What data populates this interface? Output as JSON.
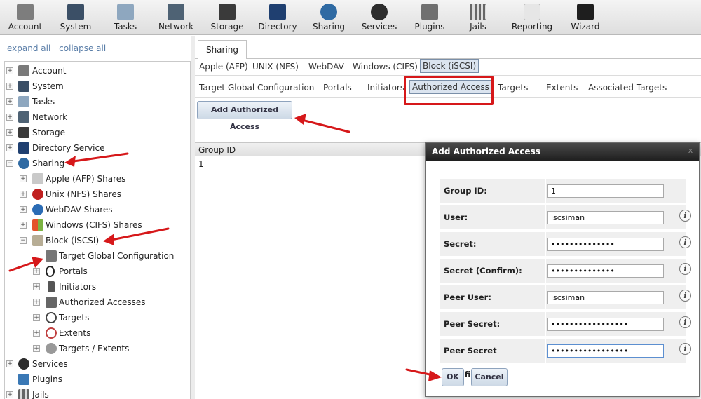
{
  "toolbar": {
    "items": [
      {
        "label": "Account",
        "icon": "account-icon"
      },
      {
        "label": "System",
        "icon": "system-icon"
      },
      {
        "label": "Tasks",
        "icon": "tasks-icon"
      },
      {
        "label": "Network",
        "icon": "network-icon"
      },
      {
        "label": "Storage",
        "icon": "storage-icon"
      },
      {
        "label": "Directory",
        "icon": "directory-icon"
      },
      {
        "label": "Sharing",
        "icon": "sharing-icon"
      },
      {
        "label": "Services",
        "icon": "services-icon"
      },
      {
        "label": "Plugins",
        "icon": "plugins-icon"
      },
      {
        "label": "Jails",
        "icon": "jails-icon"
      },
      {
        "label": "Reporting",
        "icon": "reporting-icon"
      },
      {
        "label": "Wizard",
        "icon": "wizard-icon"
      }
    ]
  },
  "left": {
    "expand_all": "expand all",
    "collapse_all": "collapse all",
    "tree": [
      {
        "label": "Account",
        "toggle": "+"
      },
      {
        "label": "System",
        "toggle": "+"
      },
      {
        "label": "Tasks",
        "toggle": "+"
      },
      {
        "label": "Network",
        "toggle": "+"
      },
      {
        "label": "Storage",
        "toggle": "+"
      },
      {
        "label": "Directory Service",
        "toggle": "+"
      },
      {
        "label": "Sharing",
        "toggle": "−"
      },
      {
        "label": "Apple (AFP) Shares",
        "toggle": "+"
      },
      {
        "label": "Unix (NFS) Shares",
        "toggle": "+"
      },
      {
        "label": "WebDAV Shares",
        "toggle": "+"
      },
      {
        "label": "Windows (CIFS) Shares",
        "toggle": "+"
      },
      {
        "label": "Block (iSCSI)",
        "toggle": "−"
      },
      {
        "label": "Target Global Configuration",
        "toggle": ""
      },
      {
        "label": "Portals",
        "toggle": "+"
      },
      {
        "label": "Initiators",
        "toggle": "+"
      },
      {
        "label": "Authorized Accesses",
        "toggle": "+"
      },
      {
        "label": "Targets",
        "toggle": "+"
      },
      {
        "label": "Extents",
        "toggle": "+"
      },
      {
        "label": "Targets / Extents",
        "toggle": "+"
      },
      {
        "label": "Services",
        "toggle": "+"
      },
      {
        "label": "Plugins",
        "toggle": ""
      },
      {
        "label": "Jails",
        "toggle": "+"
      }
    ]
  },
  "right": {
    "main_tab": "Sharing",
    "share_tabs": [
      "Apple (AFP)",
      "UNIX (NFS)",
      "WebDAV",
      "Windows (CIFS)",
      "Block (iSCSI)"
    ],
    "iscsi_tabs": [
      "Target Global Configuration",
      "Portals",
      "Initiators",
      "Authorized Access",
      "Targets",
      "Extents",
      "Associated Targets"
    ],
    "add_button": "Add Authorized Access",
    "grid": {
      "column": "Group ID",
      "rows": [
        "1"
      ]
    }
  },
  "dialog": {
    "title": "Add Authorized Access",
    "close": "x",
    "fields": [
      {
        "label": "Group ID:",
        "value": "1",
        "info": false
      },
      {
        "label": "User:",
        "value": "iscsiman",
        "info": true
      },
      {
        "label": "Secret:",
        "value": "••••••••••••••",
        "info": true
      },
      {
        "label": "Secret (Confirm):",
        "value": "••••••••••••••",
        "info": true
      },
      {
        "label": "Peer User:",
        "value": "iscsiman",
        "info": true
      },
      {
        "label": "Peer Secret:",
        "value": "•••••••••••••••••",
        "info": true
      },
      {
        "label": "Peer Secret (Confirm):",
        "value": "•••••••••••••••••",
        "info": true
      }
    ],
    "info_glyph": "i",
    "ok": "OK",
    "cancel": "Cancel"
  },
  "colors": {
    "annotation_red": "#d6181a",
    "accent_blue": "#dbe4ef",
    "title_bar": "#2a2a2a"
  }
}
